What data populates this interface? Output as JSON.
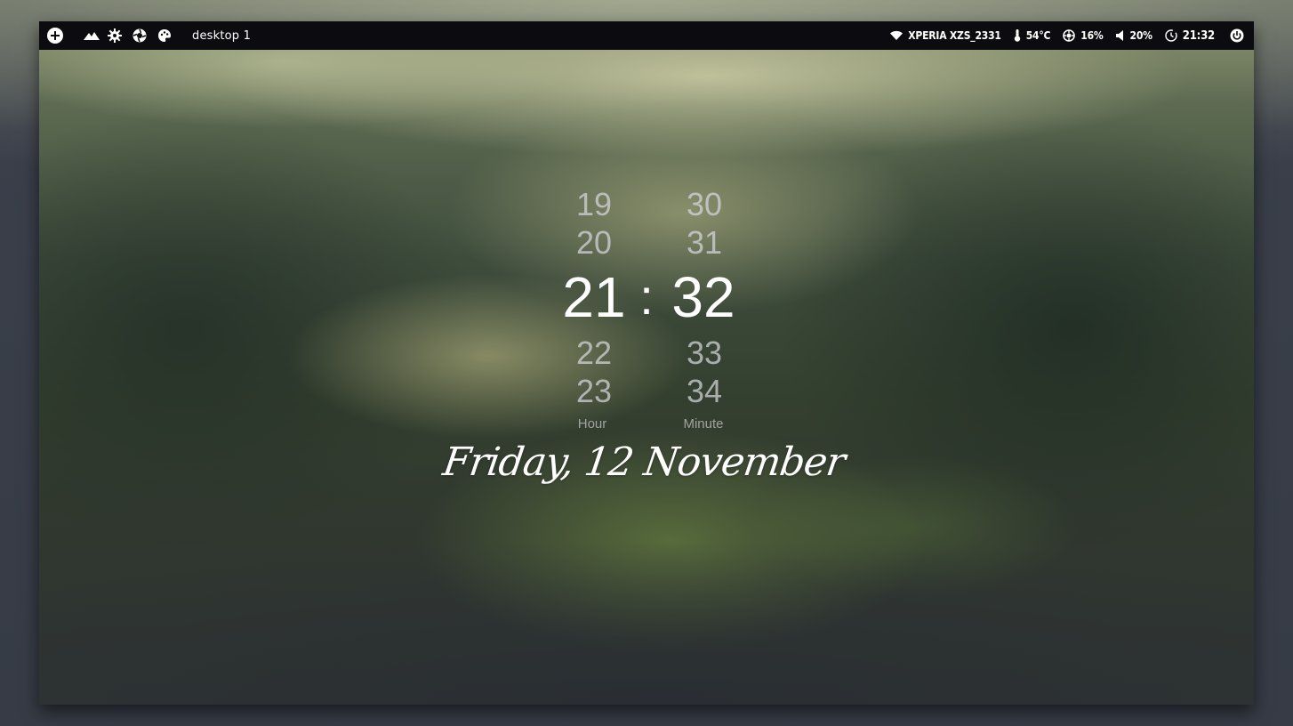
{
  "panel": {
    "workspace": "desktop 1",
    "left_icons": [
      "add-icon",
      "mountain-icon",
      "settings-gear-icon",
      "aperture-icon",
      "palette-icon"
    ],
    "wifi": {
      "icon": "wifi-icon",
      "label": "XPERIA XZS_2331"
    },
    "temperature": {
      "icon": "thermometer-icon",
      "label": "54°C"
    },
    "cpu": {
      "icon": "cpu-icon",
      "label": "16%"
    },
    "volume": {
      "icon": "speaker-icon",
      "label": "20%"
    },
    "time": {
      "icon": "clock-icon",
      "label": "21:32"
    },
    "power_icon": "power-icon"
  },
  "clock": {
    "hours_above": [
      "19",
      "20"
    ],
    "hour": "21",
    "hours_below": [
      "22",
      "23"
    ],
    "separator": ":",
    "minutes_above": [
      "30",
      "31"
    ],
    "minute": "32",
    "minutes_below": [
      "33",
      "34"
    ],
    "hour_label": "Hour",
    "minute_label": "Minute"
  },
  "date": "Friday, 12 November",
  "colors": {
    "panel_bg": "#0c0c10",
    "panel_text": "#ffffff",
    "clock_active": "#ffffff",
    "clock_inactive": "#d7d7dc"
  }
}
